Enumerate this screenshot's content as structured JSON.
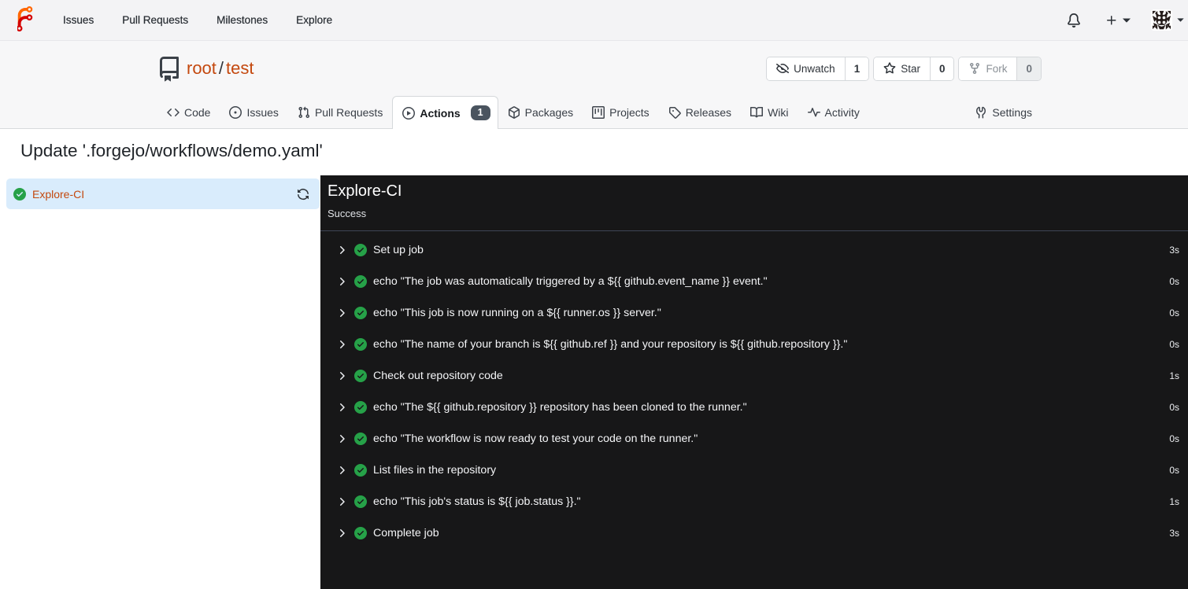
{
  "navbar": {
    "logo": "forgejo-logo",
    "links": [
      "Issues",
      "Pull Requests",
      "Milestones",
      "Explore"
    ]
  },
  "repo": {
    "owner": "root",
    "separator": "/",
    "name": "test",
    "actions": [
      {
        "icon": "eye-closed",
        "label": "Unwatch",
        "count": "1",
        "disabled": false
      },
      {
        "icon": "star",
        "label": "Star",
        "count": "0",
        "disabled": false
      },
      {
        "icon": "repo-forked",
        "label": "Fork",
        "count": "0",
        "disabled": true
      }
    ],
    "tabs": [
      {
        "icon": "code",
        "label": "Code"
      },
      {
        "icon": "issue-opened",
        "label": "Issues"
      },
      {
        "icon": "git-pull-request",
        "label": "Pull Requests"
      },
      {
        "icon": "play",
        "label": "Actions",
        "active": true,
        "badge": "1"
      },
      {
        "icon": "package",
        "label": "Packages"
      },
      {
        "icon": "project",
        "label": "Projects"
      },
      {
        "icon": "tag",
        "label": "Releases"
      },
      {
        "icon": "book",
        "label": "Wiki"
      },
      {
        "icon": "pulse",
        "label": "Activity"
      },
      {
        "icon": "tools",
        "label": "Settings",
        "right": true
      }
    ]
  },
  "run": {
    "title": "Update '.forgejo/workflows/demo.yaml'",
    "job": {
      "name": "Explore-CI",
      "status": "success"
    },
    "panel": {
      "title": "Explore-CI",
      "status_text": "Success"
    },
    "steps": [
      {
        "name": "Set up job",
        "duration": "3s"
      },
      {
        "name": "echo \"The job was automatically triggered by a ${{ github.event_name }} event.\"",
        "duration": "0s"
      },
      {
        "name": "echo \"This job is now running on a ${{ runner.os }} server.\"",
        "duration": "0s"
      },
      {
        "name": "echo \"The name of your branch is ${{ github.ref }} and your repository is ${{ github.repository }}.\"",
        "duration": "0s"
      },
      {
        "name": "Check out repository code",
        "duration": "1s"
      },
      {
        "name": "echo \"The ${{ github.repository }} repository has been cloned to the runner.\"",
        "duration": "0s"
      },
      {
        "name": "echo \"The workflow is now ready to test your code on the runner.\"",
        "duration": "0s"
      },
      {
        "name": "List files in the repository",
        "duration": "0s"
      },
      {
        "name": "echo \"This job's status is ${{ job.status }}.\"",
        "duration": "1s"
      },
      {
        "name": "Complete job",
        "duration": "3s"
      }
    ]
  },
  "colors": {
    "header_bg": "#f7f7f8",
    "navbar_bg": "#f3f3f5",
    "border": "#d5d8db",
    "link_orange": "#c4480e",
    "console_bg": "#171718",
    "success_green": "#26a148",
    "active_job_bg": "#d9ecfc",
    "badge_bg": "#4a545f"
  }
}
